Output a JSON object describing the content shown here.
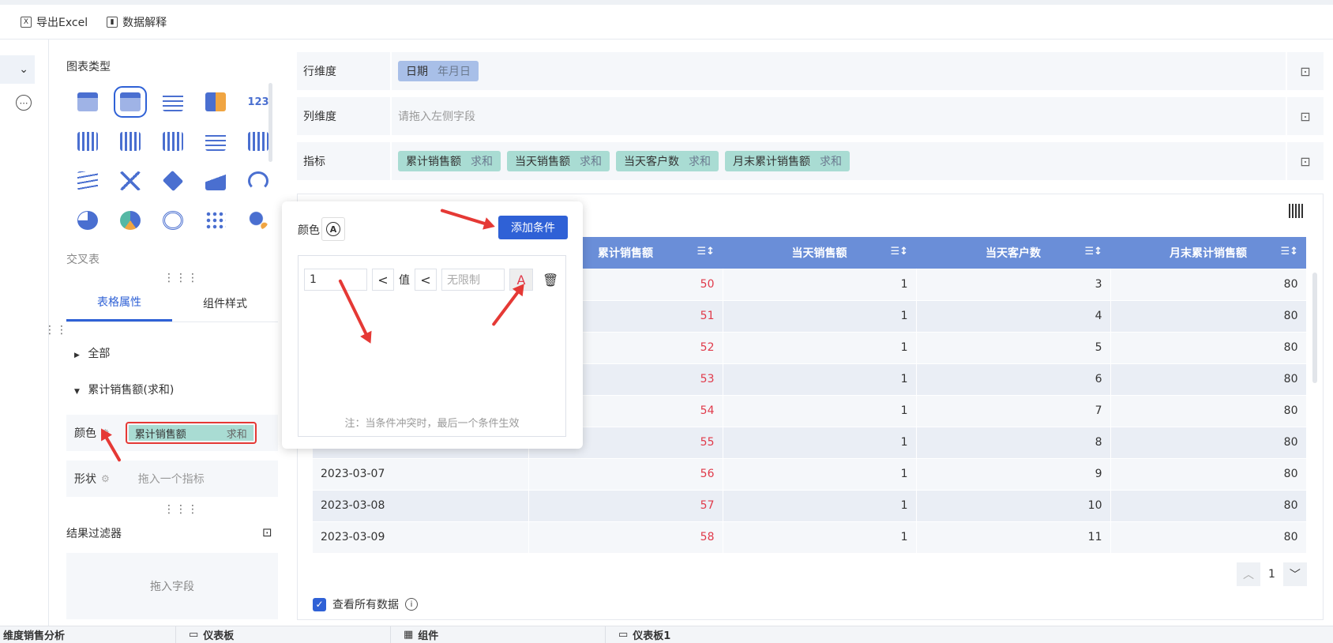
{
  "toolbar": {
    "export_excel": "导出Excel",
    "data_explain": "数据解释"
  },
  "panel": {
    "chart_type_title": "图表类型",
    "chart_type_hint": "交叉表",
    "tabs": [
      "表格属性",
      "组件样式"
    ],
    "tree": {
      "all": "全部",
      "measure": "累计销售额(求和)"
    },
    "color_label": "颜色",
    "color_chip": {
      "name": "累计销售额",
      "agg": "求和"
    },
    "shape_label": "形状",
    "shape_placeholder": "拖入一个指标",
    "result_filter": "结果过滤器",
    "result_filter_placeholder": "拖入字段"
  },
  "dims": {
    "row_label": "行维度",
    "row_chip": {
      "name": "日期",
      "sub": "年月日"
    },
    "col_label": "列维度",
    "col_placeholder": "请拖入左侧字段",
    "measure_label": "指标",
    "measure_chips": [
      {
        "name": "累计销售额",
        "sub": "求和"
      },
      {
        "name": "当天销售额",
        "sub": "求和"
      },
      {
        "name": "当天客户数",
        "sub": "求和"
      },
      {
        "name": "月末累计销售额",
        "sub": "求和"
      }
    ]
  },
  "table": {
    "headers": [
      "累计销售额",
      "当天销售额",
      "当天客户数",
      "月末累计销售额"
    ],
    "rows": [
      [
        "",
        "50",
        "1",
        "3",
        "80"
      ],
      [
        "",
        "51",
        "1",
        "4",
        "80"
      ],
      [
        "",
        "52",
        "1",
        "5",
        "80"
      ],
      [
        "",
        "53",
        "1",
        "6",
        "80"
      ],
      [
        "",
        "54",
        "1",
        "7",
        "80"
      ],
      [
        "",
        "55",
        "1",
        "8",
        "80"
      ],
      [
        "2023-03-07",
        "56",
        "1",
        "9",
        "80"
      ],
      [
        "2023-03-08",
        "57",
        "1",
        "10",
        "80"
      ],
      [
        "2023-03-09",
        "58",
        "1",
        "11",
        "80"
      ]
    ],
    "highlight_color": "#e03a4a"
  },
  "pager": {
    "page": "1"
  },
  "view_all": "查看所有数据",
  "popup": {
    "color_label": "颜色",
    "add_condition": "添加条件",
    "cond_value": "1",
    "op1": "<",
    "value_label": "值",
    "op2": "<",
    "upper_placeholder": "无限制",
    "font_glyph": "A",
    "note": "注：当条件冲突时，最后一个条件生效"
  },
  "bottom_tabs": [
    "维度销售分析",
    "仪表板",
    "组件",
    "仪表板1"
  ],
  "colors": {
    "accent": "#2f61d6",
    "header": "#6a8ed8",
    "chip_teal": "#a9dcd3",
    "chip_blue": "#a8bfe8",
    "annotation": "#e53935"
  }
}
